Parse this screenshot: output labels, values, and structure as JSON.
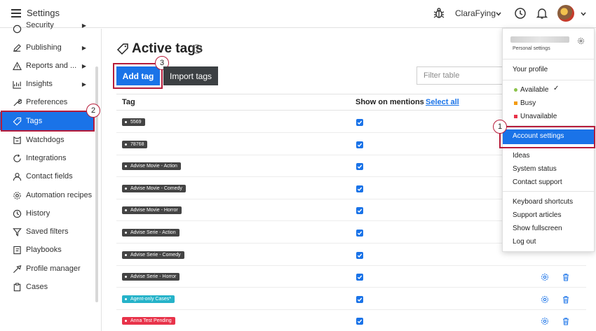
{
  "app": {
    "title": "Settings"
  },
  "header": {
    "user_name": "ClaraFying"
  },
  "sidebar": {
    "items": [
      {
        "label": "Security",
        "icon": "shield-icon",
        "arrow": "▶"
      },
      {
        "label": "Publishing",
        "icon": "pencil-icon",
        "arrow": "▶"
      },
      {
        "label": "Reports and ...",
        "icon": "warning-icon",
        "arrow": "▶"
      },
      {
        "label": "Insights",
        "icon": "insights-icon",
        "arrow": "▶"
      },
      {
        "label": "Preferences",
        "icon": "wrench-icon"
      },
      {
        "label": "Tags",
        "icon": "tag-icon"
      },
      {
        "label": "Watchdogs",
        "icon": "watchdog-icon"
      },
      {
        "label": "Integrations",
        "icon": "refresh-icon"
      },
      {
        "label": "Contact fields",
        "icon": "person-icon"
      },
      {
        "label": "Automation recipes",
        "icon": "gear-icon"
      },
      {
        "label": "History",
        "icon": "history-icon"
      },
      {
        "label": "Saved filters",
        "icon": "filter-icon"
      },
      {
        "label": "Playbooks",
        "icon": "book-icon"
      },
      {
        "label": "Profile manager",
        "icon": "profile-icon"
      },
      {
        "label": "Cases",
        "icon": "clipboard-icon"
      }
    ]
  },
  "main": {
    "title": "Active tags",
    "add_tag": "Add tag",
    "import_tags": "Import tags",
    "filter_placeholder": "Filter table",
    "columns": {
      "tag": "Tag",
      "show_on_mentions": "Show on mentions",
      "select_all": "Select all"
    },
    "rows": [
      {
        "tag": "5569",
        "color": "#444444",
        "checked": true
      },
      {
        "tag": "78768",
        "color": "#444444",
        "checked": true
      },
      {
        "tag": "Advise Movie - Action",
        "color": "#444444",
        "checked": true
      },
      {
        "tag": "Advise Movie - Comedy",
        "color": "#444444",
        "checked": true
      },
      {
        "tag": "Advise Movie - Horror",
        "color": "#444444",
        "checked": true
      },
      {
        "tag": "Advise Serie - Action",
        "color": "#444444",
        "checked": true
      },
      {
        "tag": "Advise Serie - Comedy",
        "color": "#444444",
        "checked": true
      },
      {
        "tag": "Advise Serie - Horror",
        "color": "#444444",
        "checked": true
      },
      {
        "tag": "Agent-only Cases*",
        "color": "#26b3c9",
        "checked": true
      },
      {
        "tag": "Anna Test Pending",
        "color": "#e8334a",
        "checked": true
      }
    ]
  },
  "dropdown": {
    "subtitle": "Personal settings",
    "your_profile": "Your profile",
    "statuses": [
      {
        "label": "Available",
        "color": "#8bc34a",
        "checkmark": "✓"
      },
      {
        "label": "Busy",
        "color": "#f39c12"
      },
      {
        "label": "Unavailable",
        "color": "#e8334a"
      }
    ],
    "account_settings": "Account settings",
    "group2": [
      "Ideas",
      "System status",
      "Contact support"
    ],
    "group3": [
      "Keyboard shortcuts",
      "Support articles",
      "Show fullscreen",
      "Log out"
    ]
  },
  "annotations": {
    "step1": "1",
    "step2": "2",
    "step3": "3"
  },
  "colors": {
    "accent": "#1a73e8",
    "highlight": "#b71c3a",
    "dark_button": "#3c4043"
  }
}
